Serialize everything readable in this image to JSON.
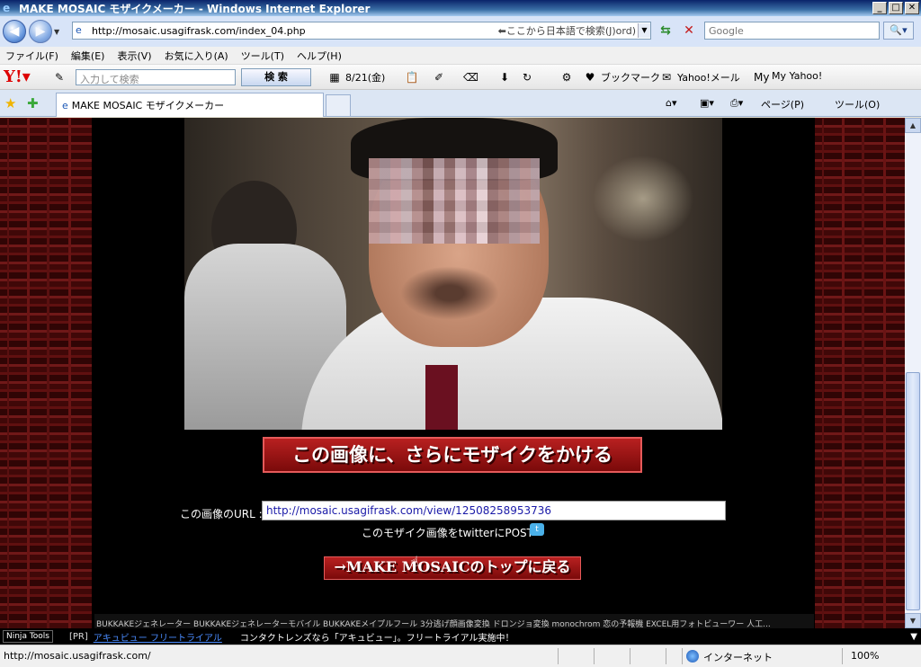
{
  "window": {
    "title": "MAKE MOSAIC モザイクメーカー - Windows Internet Explorer",
    "buttons": [
      "_",
      "□",
      "✕"
    ]
  },
  "address": {
    "url": "http://mosaic.usagifrask.com/index_04.php",
    "hint": "⬅ここから日本語で検索(J)ord)",
    "search_placeholder": "Google"
  },
  "menu": [
    "ファイル(F)",
    "編集(E)",
    "表示(V)",
    "お気に入り(A)",
    "ツール(T)",
    "ヘルプ(H)"
  ],
  "yahoo_toolbar": {
    "search_placeholder": "入力して検索",
    "search_button": "検 索",
    "date": "8/21(金)",
    "bookmarks": "ブックマーク",
    "mail": "Yahoo!メール",
    "myyahoo": "My Yahoo!"
  },
  "tabs": {
    "active": "MAKE MOSAIC モザイクメーカー",
    "page_label": "ページ(P)",
    "tools_label": "ツール(O)"
  },
  "content": {
    "mosaic_button": "この画像に、さらにモザイクをかける",
    "url_label": "この画像のURL :",
    "image_url": "http://mosaic.usagifrask.com/view/12508258953736",
    "post_text": "このモザイク画像をtwitterにPOST→",
    "top_button": "→MAKE MOSAICのトップに戻る",
    "footer": "BUKKAKEジェネレーター  BUKKAKEジェネレーターモバイル  BUKKAKEメイプルフール  3分逃げ顔画像変換  ドロンジョ変換  monochrom  恋の予報機  EXCEL用フォトビューワー  人工..."
  },
  "ninja": {
    "label": "Ninja Tools",
    "pr": "[PR]",
    "link": "アキュビュー フリートライアル",
    "text": "コンタクトレンズなら「アキュビュー」。フリートライアル実施中！"
  },
  "status": {
    "url": "http://mosaic.usagifrask.com/",
    "zone": "インターネット",
    "zoom": "100%"
  }
}
